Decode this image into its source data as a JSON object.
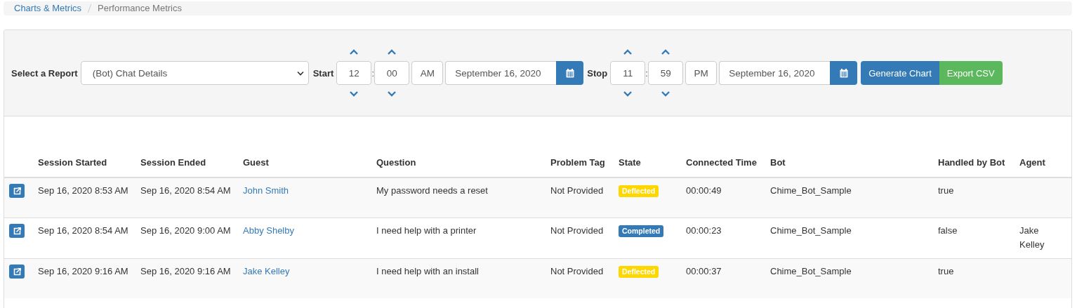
{
  "breadcrumb": [
    {
      "label": "Charts & Metrics",
      "current": false
    },
    {
      "label": "Performance Metrics",
      "current": true
    }
  ],
  "toolbar": {
    "report_label": "Select a Report",
    "report_value": "(Bot) Chat Details",
    "ranges": [
      {
        "label": "Start",
        "hour": "12",
        "separator": ":",
        "minute": "00",
        "period": "AM",
        "date": "September 16, 2020"
      },
      {
        "label": "Stop",
        "hour": "11",
        "separator": ":",
        "minute": "59",
        "period": "PM",
        "date": "September 16, 2020"
      }
    ],
    "buttons": [
      {
        "label": "Generate Chart",
        "kind": "primary"
      },
      {
        "label": "Export CSV",
        "kind": "success"
      }
    ]
  },
  "table": {
    "columns": [
      "Session Started",
      "Session Ended",
      "Guest",
      "Question",
      "Problem Tag",
      "State",
      "Connected Time",
      "Bot",
      "Handled by Bot",
      "Agent"
    ],
    "rows": [
      {
        "session_started": "Sep 16, 2020 8:53 AM",
        "session_ended": "Sep 16, 2020 8:54 AM",
        "guest": "John Smith",
        "question": "My password needs a reset",
        "problem_tag": "Not Provided",
        "state": {
          "label": "Deflected",
          "color": "#ffd700"
        },
        "connected_time": "00:00:49",
        "bot": "Chime_Bot_Sample",
        "handled_by_bot": "true"
      },
      {
        "session_started": "Sep 16, 2020 8:54 AM",
        "session_ended": "Sep 16, 2020 9:00 AM",
        "guest": "Abby Shelby",
        "question": "I need help with a printer",
        "problem_tag": "Not Provided",
        "state": {
          "label": "Completed",
          "color": "#337ab7"
        },
        "connected_time": "00:00:23",
        "bot": "Chime_Bot_Sample",
        "handled_by_bot": "false",
        "agent": "Jake Kelley"
      },
      {
        "session_started": "Sep 16, 2020 9:16 AM",
        "session_ended": "Sep 16, 2020 9:16 AM",
        "guest": "Jake Kelley",
        "question": "I need help with an install",
        "problem_tag": "Not Provided",
        "state": {
          "label": "Deflected",
          "color": "#ffd700"
        },
        "connected_time": "00:00:37",
        "bot": "Chime_Bot_Sample",
        "handled_by_bot": "true"
      }
    ]
  }
}
